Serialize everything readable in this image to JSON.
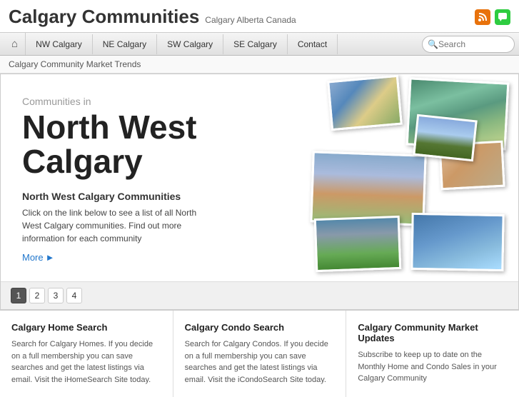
{
  "header": {
    "title": "Calgary Communities",
    "subtitle": "Calgary Alberta Canada",
    "rss_icon": "📶",
    "chat_icon": "💬"
  },
  "nav": {
    "home_icon": "⌂",
    "items": [
      {
        "label": "NW Calgary",
        "id": "nw-calgary"
      },
      {
        "label": "NE Calgary",
        "id": "ne-calgary"
      },
      {
        "label": "SW Calgary",
        "id": "sw-calgary"
      },
      {
        "label": "SE Calgary",
        "id": "se-calgary"
      },
      {
        "label": "Contact",
        "id": "contact"
      }
    ],
    "search_placeholder": "Search"
  },
  "breadcrumb": {
    "text": "Calgary Community Market Trends"
  },
  "hero": {
    "subtitle": "Communities in",
    "title": "North West\nCalgary",
    "section_title": "North West Calgary Communities",
    "description": "Click on the link below to see a list of all North West Calgary communities. Find out more information for each community",
    "more_label": "More"
  },
  "pagination": {
    "pages": [
      "1",
      "2",
      "3",
      "4"
    ],
    "active": "1"
  },
  "cards": [
    {
      "title": "Calgary Home Search",
      "text": "Search for Calgary Homes. If you decide on a full membership you can save searches and get the latest listings via email. Visit the iHomeSearch Site today."
    },
    {
      "title": "Calgary Condo Search",
      "text": "Search for Calgary Condos. If you decide on a full membership you can save searches and get the latest listings via email. Visit the iCondoSearch Site today."
    },
    {
      "title": "Calgary Community Market Updates",
      "text": "Subscribe to keep up to date on the Monthly Home and Condo Sales in your Calgary Community"
    }
  ]
}
